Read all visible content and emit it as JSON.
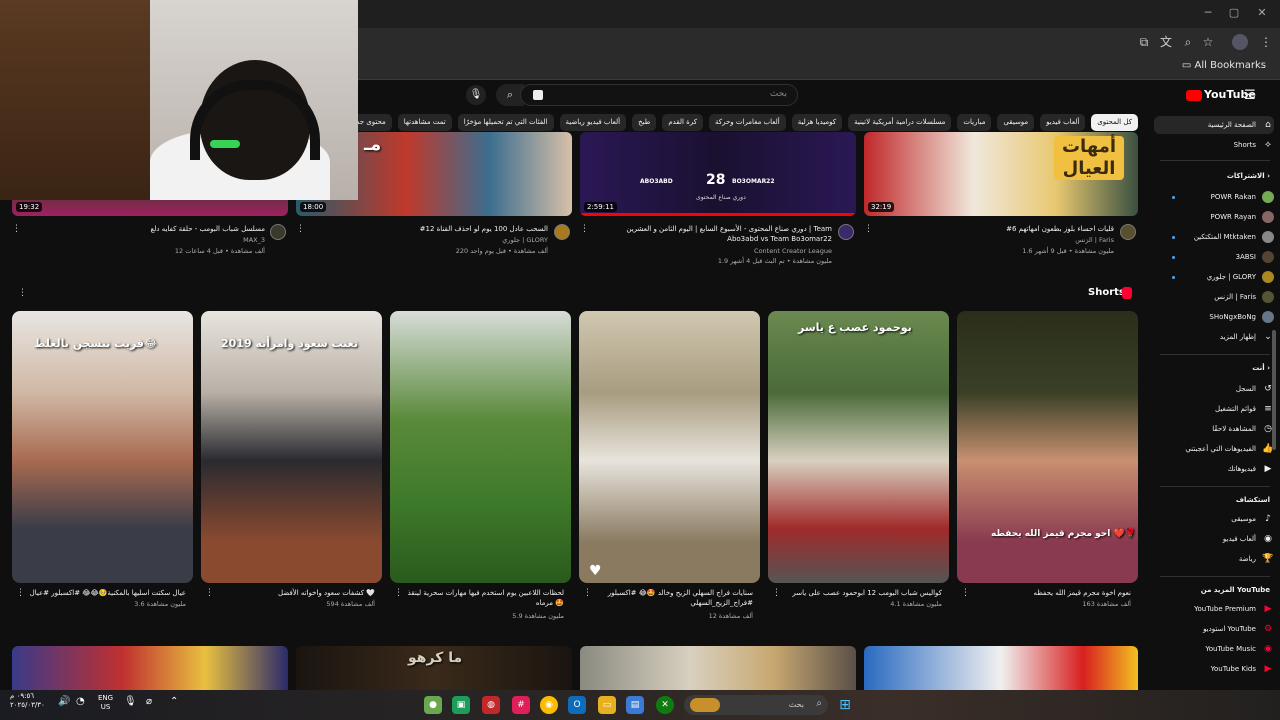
{
  "browser": {
    "bookmarks_label": "All Bookmarks"
  },
  "youtube": {
    "logo_text": "YouTube",
    "search_placeholder": "بحث",
    "chips": [
      "كل المحتوى",
      "ألعاب فيديو",
      "موسيقى",
      "مباريات",
      "مسلسلات درامية أمريكية لاتينية",
      "كوميديا هزلية",
      "ألعاب مغامرات وحركة",
      "كرة القدم",
      "طبخ",
      "ألعاب فيديو رياضية",
      "الفئات التي تم تحميلها مؤخرًا",
      "تمت مشاهدتها",
      "محتوى جديد لك"
    ],
    "sidebar": {
      "home": "الصفحة الرئيسية",
      "shorts": "Shorts",
      "subs_heading": "الاشتراكات",
      "subs": [
        "POWR Rakan",
        "POWR Rayan",
        "المتكتكين Mtktaken",
        "3ABSI",
        "جلوري | GLORY",
        "الزنس | Faris",
        "SHoNgxBoNg"
      ],
      "show_more": "إظهار المزيد",
      "you_heading": "أنت",
      "you_items": [
        "السجل",
        "قوائم التشغيل",
        "المشاهدة لاحقًا",
        "الفيديوهات التي أعجبتني",
        "فيديوهاتك"
      ],
      "explore_heading": "استكشاف",
      "explore_items": [
        "موسيقى",
        "ألعاب فيديو",
        "رياضة"
      ],
      "more_heading": "المزيد من YouTube",
      "more_items": [
        "YouTube Premium",
        "استوديو YouTube",
        "YouTube Music",
        "YouTube Kids"
      ]
    },
    "top_videos": [
      {
        "duration": "19:32",
        "title": "مسلسل شباب البومب - حلقة كفايه دلع",
        "channel": "MAX_3",
        "meta": "12 ألف مشاهدة • قبل 4 ساعات"
      },
      {
        "duration": "18:00",
        "title": "#12 السحب عادل 100 يوم لو احذف القناة",
        "channel": "جلوري | GLORY",
        "meta": "220 ألف مشاهدة • قبل يوم واحد"
      },
      {
        "duration": "2:59:11",
        "title": "دوري صناع المحتوى - الأسبوع السابع | اليوم الثامن و العشرين | Team Abo3abd vs Team Bo3omar22",
        "channel": "Content Creator League",
        "meta": "1.9 مليون مشاهدة • تم البث قبل 4 أشهر",
        "overlay_left": "ABO3ABD",
        "overlay_num": "28",
        "overlay_right": "BO3OMAR22",
        "overlay_sub": "دوري صناع المحتوى"
      },
      {
        "duration": "32:19",
        "title": "#6 قليات احساء بلوز بطعون امهاتهم",
        "channel": "الزنس | Faris",
        "meta": "1.6 مليون مشاهدة • قبل 9 أشهر",
        "overlay": "أمهات العيال"
      }
    ],
    "top_left_overlay": "مـ",
    "shorts_label": "Shorts",
    "shorts": [
      {
        "caption": "قريت تنسجن بالغلط😂",
        "title": "عيال سكتت اسليها بالمكنية🥺😂😂 #اكسبلور #عيال",
        "views": "3.6 مليون مشاهدة"
      },
      {
        "caption": "2019 تعنت سعود وامرأته",
        "title": "كشفات سعود واخواته الأفضل 🤍",
        "views": "594 ألف مشاهدة"
      },
      {
        "caption": "",
        "title": "لحظات اللاعبين يوم استخدم فيها مهارات سحرية لينقذ مرماه 🤩",
        "views": "5.9 مليون مشاهدة"
      },
      {
        "caption": "",
        "title": "سنايات فراج السهلي الزيح وخالد 🤩😂 #اكسبلور #فراج_الزيح_السهلي",
        "views": "12 ألف مشاهدة"
      },
      {
        "caption": "بوحمود عصب ع ياسر",
        "title": "كواليس شباب البومب 12 ابوحمود عصب على ياسر",
        "views": "4.1 مليون مشاهدة"
      },
      {
        "caption": "احو مجرم قيمز الله يحفظه ❤️🌹",
        "title": "نعوم اخوة مجرم قيمز الله يحفظه",
        "views": "163 ألف مشاهدة"
      }
    ],
    "bottom_overlay": "ما كرهو"
  },
  "taskbar": {
    "search_placeholder": "بحث",
    "time": "٠٩:٥٦ م",
    "date": "٢٠٢٥/٠٣/٣٠",
    "lang": "ENG",
    "region": "US"
  }
}
